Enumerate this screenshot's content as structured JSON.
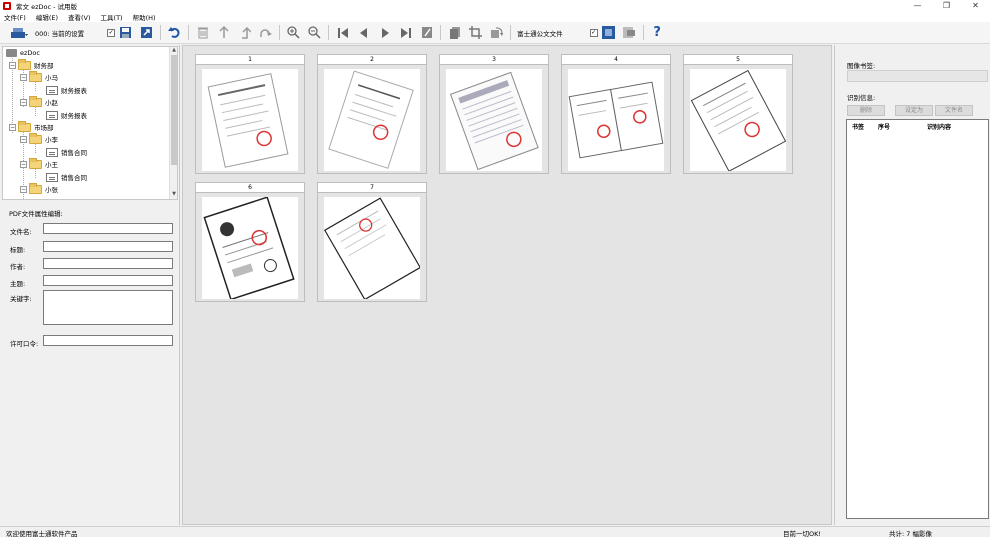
{
  "window": {
    "title": "紫文 ezDoc - 试用版",
    "controls": [
      "—",
      "❐",
      "✕"
    ]
  },
  "menu": [
    "文件(F)",
    "编辑(E)",
    "查看(V)",
    "工具(T)",
    "帮助(H)"
  ],
  "toolbar": {
    "profile_label": "000: 当前的设置",
    "profile_checked": "✓",
    "doc_type": "富士通公文文件",
    "doc_type_checked": "✓",
    "help_label": "?"
  },
  "tree": {
    "items": [
      {
        "label": "ezDoc",
        "level": 0
      },
      {
        "label": "财务部",
        "level": 1
      },
      {
        "label": "小马",
        "level": 2
      },
      {
        "label": "财务报表",
        "level": 3
      },
      {
        "label": "小赵",
        "level": 2
      },
      {
        "label": "财务报表",
        "level": 3
      },
      {
        "label": "市场部",
        "level": 1
      },
      {
        "label": "小李",
        "level": 2
      },
      {
        "label": "销售合同",
        "level": 3
      },
      {
        "label": "小王",
        "level": 2
      },
      {
        "label": "销售合同",
        "level": 3
      },
      {
        "label": "小张",
        "level": 2
      }
    ],
    "toggles": [
      "−",
      "−",
      "−",
      "−",
      "−",
      "−",
      "−",
      "−",
      "−"
    ]
  },
  "pdf_props": {
    "title": "PDF文件属性编辑:",
    "filename_label": "文件名:",
    "title_label": "标题:",
    "author_label": "作者:",
    "subject_label": "主题:",
    "keywords_label": "关键字:",
    "password_label": "许可口令:"
  },
  "thumbnails": [
    "1",
    "2",
    "3",
    "4",
    "5",
    "6",
    "7"
  ],
  "right_panel": {
    "bookmark_label": "图像书签:",
    "recognize_label": "识别信息:",
    "delete_btn": "删除",
    "set_btn": "设定为",
    "filename_btn": "文件名",
    "col_bookmark": "书签",
    "col_seq": "序号",
    "col_content": "识别内容"
  },
  "status": {
    "left": "欢迎使用富士通软件产品",
    "middle": "目前一切OK!",
    "right": "共计: 7 幅影像"
  }
}
